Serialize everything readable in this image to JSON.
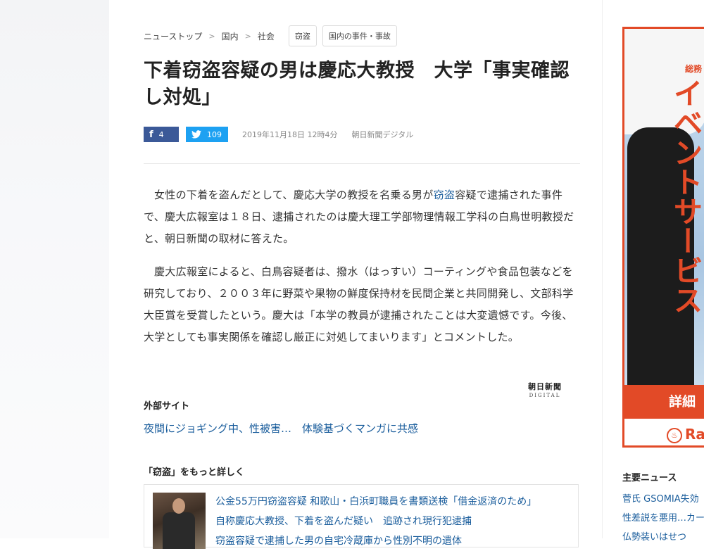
{
  "breadcrumb": {
    "items": [
      "ニューストップ",
      "国内",
      "社会"
    ],
    "tags": [
      "窃盗",
      "国内の事件・事故"
    ]
  },
  "article": {
    "headline": "下着窃盗容疑の男は慶応大教授　大学「事実確認し対処」",
    "share": {
      "facebook_count": "4",
      "twitter_count": "109"
    },
    "date": "2019年11月18日 12時4分",
    "source": "朝日新聞デジタル",
    "paragraphs": [
      {
        "before": "女性の下着を盗んだとして、慶応大学の教授を名乗る男が",
        "keyword": "窃盗",
        "after": "容疑で逮捕された事件で、慶大広報室は１８日、逮捕されたのは慶大理工学部物理情報工学科の白鳥世明教授だと、朝日新聞の取材に答えた。"
      },
      {
        "text": "慶大広報室によると、白鳥容疑者は、撥水（はっすい）コーティングや食品包装などを研究しており、２００３年に野菜や果物の鮮度保持材を民間企業と共同開発し、文部科学大臣賞を受賞したという。慶大は「本学の教員が逮捕されたことは大変遺憾です。今後、大学としても事実関係を確認し厳正に対処してまいります」とコメントした。"
      }
    ],
    "logo": {
      "jp": "朝日新聞",
      "en": "DIGITAL"
    }
  },
  "external": {
    "title": "外部サイト",
    "links": [
      "夜間にジョギング中、性被害…　体験基づくマンガに共感"
    ]
  },
  "more": {
    "title": "「窃盗」をもっと詳しく",
    "items": [
      "公金55万円窃盗容疑 和歌山・白浜町職員を書類送検「借金返済のため」",
      "自称慶応大教授、下着を盗んだ疑い　追跡され現行犯逮捕",
      "窃盗容疑で逮捕した男の自宅冷蔵庫から性別不明の遺体"
    ]
  },
  "ad": {
    "brand": "総務",
    "vertical_text": "イベントサービス",
    "detail_label": "詳細",
    "footer_label": "Ra"
  },
  "sidebar_news": {
    "title": "主要ニュース",
    "items": [
      "菅氏 GSOMIA失効",
      "性差説を悪用…カー",
      "仏勢装いはせつ"
    ]
  },
  "colors": {
    "link": "#1a5d9c",
    "facebook": "#3b5998",
    "twitter": "#1da1f2",
    "ad_accent": "#e24a27"
  }
}
